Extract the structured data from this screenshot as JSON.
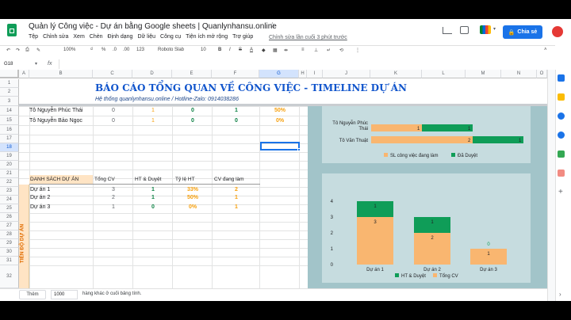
{
  "doc": {
    "title": "Quản lý Công việc - Dự án bằng Google sheets | Quanlynhansu.online",
    "star": "☆"
  },
  "menu": [
    "Tệp",
    "Chỉnh sửa",
    "Xem",
    "Chèn",
    "Định dạng",
    "Dữ liệu",
    "Công cụ",
    "Tiện ích mở rộng",
    "Trợ giúp"
  ],
  "last_edit": "Chỉnh sửa lần cuối 3 phút trước",
  "share_label": "Chia sẻ",
  "toolbar": {
    "zoom": "100%",
    "currency": "₫",
    "percent": "%",
    "dec0": ".0",
    "dec00": ".00",
    "numfmt": "123",
    "font": "Roboto Slab",
    "size": "10",
    "bold": "B",
    "italic": "I",
    "strike": "S",
    "color": "A"
  },
  "namebox": "G18",
  "fx": "fx",
  "columns": [
    "A",
    "B",
    "C",
    "D",
    "E",
    "F",
    "G",
    "H",
    "I",
    "J",
    "K",
    "L",
    "M",
    "N",
    "O"
  ],
  "rows": [
    "1",
    "2",
    "3",
    "14",
    "15",
    "16",
    "17",
    "18",
    "19",
    "20",
    "21",
    "22",
    "23",
    "24",
    "25",
    "26",
    "27",
    "28",
    "29",
    "30",
    "31",
    "32"
  ],
  "report": {
    "title": "BÁO CÁO TỔNG QUAN VỀ CÔNG VIỆC - TIMELINE DỰ ÁN",
    "subtitle": "Hệ thống quanlynhansu.online / Hotline-Zalo: 0914038286"
  },
  "people": [
    {
      "name": "Tô Nguyễn Phúc Thái",
      "c": "0",
      "d": "1",
      "e": "0",
      "f": "1",
      "g": "50%"
    },
    {
      "name": "Tô Nguyễn Bảo Ngọc",
      "c": "0",
      "d": "1",
      "e": "0",
      "f": "0",
      "g": "0%"
    }
  ],
  "projects": {
    "headers": [
      "DANH SÁCH DỰ ÁN",
      "Tổng CV",
      "HT & Duyệt",
      "Tỷ lệ HT",
      "CV đang làm"
    ],
    "side_label": "TIẾN ĐỘ DỰ ÁN",
    "rows": [
      {
        "name": "Dự án 1",
        "total": "3",
        "done": "1",
        "rate": "33%",
        "doing": "2"
      },
      {
        "name": "Dự án 2",
        "total": "2",
        "done": "1",
        "rate": "50%",
        "doing": "1"
      },
      {
        "name": "Dự án 3",
        "total": "1",
        "done": "0",
        "rate": "0%",
        "doing": "1"
      }
    ]
  },
  "bottom": {
    "add_label": "Thêm",
    "add_value": "1000",
    "add_suffix": "hàng khác ở cuối bảng tính."
  },
  "colors": {
    "green": "#0f9d58",
    "orange": "#f9b670",
    "panel": "#a2c4c9"
  },
  "chart_data": [
    {
      "type": "bar",
      "orientation": "horizontal",
      "stacked": true,
      "categories": [
        "Tô Nguyễn Phúc Thái",
        "Tô Văn Thuật"
      ],
      "category_labels": [
        "Tô Nguyễn Phúc\nThái",
        "Tô Văn Thuật"
      ],
      "series": [
        {
          "name": "SL công việc đang làm",
          "values": [
            1,
            2
          ],
          "color": "#f9b670"
        },
        {
          "name": "Đã Duyệt",
          "values": [
            1,
            1
          ],
          "color": "#0f9d58"
        }
      ],
      "legend": "bottom"
    },
    {
      "type": "bar",
      "stacked": true,
      "categories": [
        "Dự án 1",
        "Dự án 2",
        "Dự án 3"
      ],
      "series": [
        {
          "name": "Tổng CV",
          "values": [
            3,
            2,
            1
          ],
          "color": "#f9b670"
        },
        {
          "name": "HT & Duyệt",
          "values": [
            1,
            1,
            0
          ],
          "color": "#0f9d58"
        }
      ],
      "ylim": [
        0,
        4
      ],
      "yticks": [
        "0",
        "1",
        "2",
        "3",
        "4"
      ],
      "legend": "bottom"
    }
  ]
}
